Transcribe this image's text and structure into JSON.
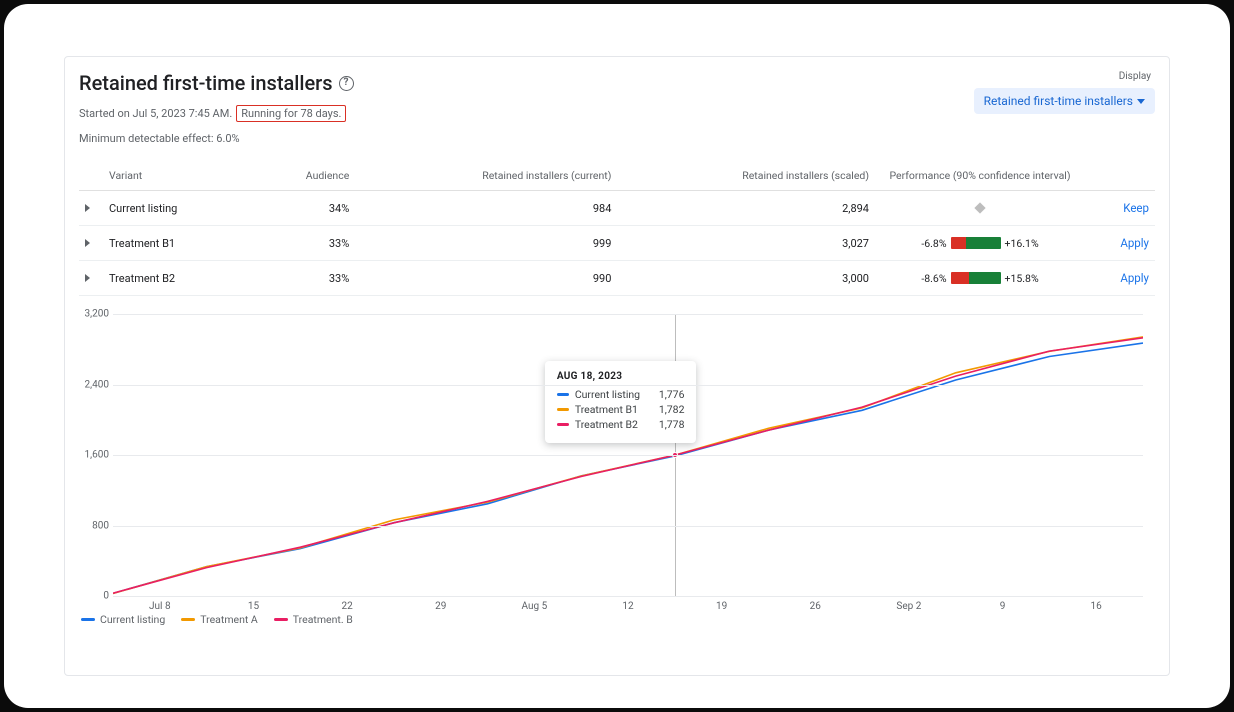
{
  "header": {
    "title": "Retained first-time installers",
    "started_label": "Started on Jul 5, 2023 7:45 AM.",
    "running_label": "Running for 78 days.",
    "mde_label": "Minimum detectable effect: 6.0%",
    "display_label": "Display",
    "display_value": "Retained first-time installers"
  },
  "table": {
    "cols": {
      "variant": "Variant",
      "audience": "Audience",
      "current": "Retained installers (current)",
      "scaled": "Retained installers (scaled)",
      "perf": "Performance (90% confidence interval)"
    },
    "rows": [
      {
        "variant": "Current listing",
        "audience": "34%",
        "current": "984",
        "scaled": "2,894",
        "low": "",
        "high": "",
        "action": "Keep",
        "baseline": true
      },
      {
        "variant": "Treatment B1",
        "audience": "33%",
        "current": "999",
        "scaled": "3,027",
        "low": "-6.8%",
        "high": "+16.1%",
        "badW": 15,
        "goodW": 35,
        "action": "Apply",
        "baseline": false
      },
      {
        "variant": "Treatment B2",
        "audience": "33%",
        "current": "990",
        "scaled": "3,000",
        "low": "-8.6%",
        "high": "+15.8%",
        "badW": 18,
        "goodW": 32,
        "action": "Apply",
        "baseline": false
      }
    ]
  },
  "tooltip": {
    "date": "AUG 18, 2023",
    "rows": [
      {
        "label": "Current listing",
        "value": "1,776",
        "color": "#1a73e8"
      },
      {
        "label": "Treatment B1",
        "value": "1,782",
        "color": "#f29900"
      },
      {
        "label": "Treatment B2",
        "value": "1,778",
        "color": "#e91e63"
      }
    ]
  },
  "legend": [
    {
      "label": "Current listing",
      "color": "#1a73e8"
    },
    {
      "label": "Treatment A",
      "color": "#f29900"
    },
    {
      "label": "Treatment. B",
      "color": "#e91e63"
    }
  ],
  "chart_data": {
    "type": "line",
    "title": "Retained first-time installers over time",
    "xlabel": "",
    "ylabel": "",
    "y_ticks": [
      0,
      800,
      1600,
      2400,
      3200
    ],
    "ylim": [
      0,
      3200
    ],
    "x_categories": [
      "Jul 8",
      "15",
      "22",
      "29",
      "Aug 5",
      "12",
      "19",
      "26",
      "Sep 2",
      "9",
      "16"
    ],
    "series": [
      {
        "name": "Current listing",
        "color": "#1a73e8",
        "values": [
          30,
          300,
          560,
          820,
          1080,
          1340,
          1600,
          1860,
          2130,
          2440,
          2740,
          2870
        ]
      },
      {
        "name": "Treatment A",
        "color": "#f29900",
        "values": [
          28,
          310,
          570,
          830,
          1100,
          1350,
          1610,
          1880,
          2170,
          2510,
          2800,
          2940
        ]
      },
      {
        "name": "Treatment B",
        "color": "#e91e63",
        "values": [
          32,
          305,
          565,
          825,
          1090,
          1345,
          1605,
          1870,
          2155,
          2490,
          2790,
          2930
        ]
      }
    ],
    "tooltip_index": 6,
    "n_points": 12
  }
}
